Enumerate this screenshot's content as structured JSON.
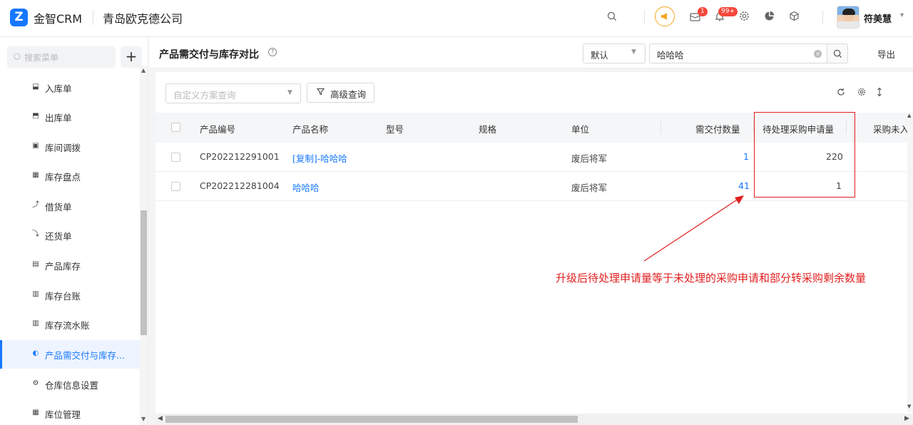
{
  "header": {
    "logo_letter": "Z",
    "brand": "金智CRM",
    "company": "青岛欧克德公司",
    "messages_badge": "1",
    "notifications_badge": "99+",
    "username": "符美慧"
  },
  "sidebar": {
    "search_placeholder": "搜索菜单",
    "add_label": "+",
    "items": [
      {
        "label": "入库单",
        "icon": "inbound-icon"
      },
      {
        "label": "出库单",
        "icon": "outbound-icon"
      },
      {
        "label": "库间调拨",
        "icon": "transfer-icon"
      },
      {
        "label": "库存盘点",
        "icon": "inventory-check-icon"
      },
      {
        "label": "借货单",
        "icon": "borrow-icon"
      },
      {
        "label": "还货单",
        "icon": "return-icon"
      },
      {
        "label": "产品库存",
        "icon": "product-stock-icon"
      },
      {
        "label": "库存台账",
        "icon": "ledger-icon"
      },
      {
        "label": "库存流水账",
        "icon": "journal-icon"
      },
      {
        "label": "产品需交付与库存...",
        "icon": "half-circle-icon",
        "active": true
      },
      {
        "label": "仓库信息设置",
        "icon": "gear-icon"
      },
      {
        "label": "库位管理",
        "icon": "grid-icon"
      }
    ]
  },
  "page": {
    "title": "产品需交付与库存对比",
    "view_select": "默认",
    "search_value": "哈哈哈",
    "export_label": "导出",
    "scheme_placeholder": "自定义方案查询",
    "advanced_query_label": "高级查询"
  },
  "table": {
    "columns": [
      "产品编号",
      "产品名称",
      "型号",
      "规格",
      "单位",
      "需交付数量",
      "待处理采购申请量",
      "采购未入"
    ],
    "rows": [
      {
        "code": "CP202212291001",
        "name": "[复制]-哈哈哈",
        "model": "",
        "spec": "",
        "unit": "废后将军",
        "deliver_qty": "1",
        "pending_purchase": "220"
      },
      {
        "code": "CP202212281004",
        "name": "哈哈哈",
        "model": "",
        "spec": "",
        "unit": "废后将军",
        "deliver_qty": "41",
        "pending_purchase": "1"
      }
    ]
  },
  "annotation": {
    "text": "升级后待处理申请量等于未处理的采购申请和部分转采购剩余数量",
    "color": "#e02020"
  },
  "colors": {
    "accent": "#1677ff",
    "badge": "#f5483b",
    "speaker": "#f5a623"
  }
}
